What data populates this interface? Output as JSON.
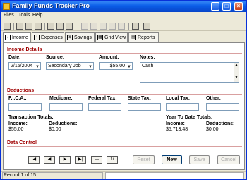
{
  "window": {
    "title": "Family Funds Tracker Pro"
  },
  "menu": [
    "Files",
    "Tools",
    "Help"
  ],
  "tabs": [
    "Income",
    "Expenses",
    "Savings",
    "Grid View",
    "Reports"
  ],
  "income_details": {
    "section_title": "Income Details",
    "date_label": "Date:",
    "date_value": "2/15/2004",
    "source_label": "Source:",
    "source_value": "Secondary Job",
    "amount_label": "Amount:",
    "amount_value": "$55.00",
    "notes_label": "Notes:",
    "notes_value": "Cash"
  },
  "deductions": {
    "section_title": "Deductions",
    "fica_label": "F.I.C.A.:",
    "medicare_label": "Medicare:",
    "federal_label": "Federal Tax:",
    "state_label": "State Tax:",
    "local_label": "Local Tax:",
    "other_label": "Other:"
  },
  "transaction_totals": {
    "title": "Transaction Totals:",
    "income_label": "Income:",
    "income_value": "$55.00",
    "deductions_label": "Deductions:",
    "deductions_value": "$0.00"
  },
  "ytd_totals": {
    "title": "Year To Date Totals:",
    "income_label": "Income:",
    "income_value": "$5,713.48",
    "deductions_label": "Deductions:",
    "deductions_value": "$0.00"
  },
  "data_control": {
    "section_title": "Data Control",
    "reset_label": "Reset",
    "new_label": "New",
    "save_label": "Save",
    "cancel_label": "Cancel"
  },
  "status": {
    "record_text": "Record 1 of 15"
  },
  "colors": {
    "titlebar": "#0a5ee8",
    "section": "#a00000"
  }
}
